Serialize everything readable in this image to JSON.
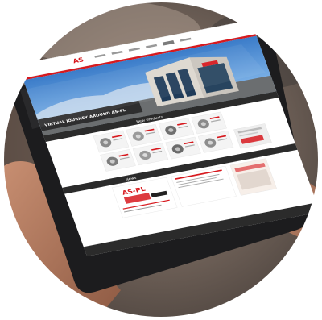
{
  "photo": {
    "subject": "tablet-showing-website",
    "colors": {
      "background_blur": "#7a6a5e",
      "tablet_frame": "#1c1c1e",
      "page_bg": "#ffffff",
      "accent_red": "#d7191e",
      "header_dark": "#2b2b2b"
    }
  },
  "website": {
    "logo": "AS",
    "nav": [
      "",
      "",
      "",
      "",
      ""
    ],
    "hero_caption": "VIRTUAL JOURNEY AROUND AS-PL",
    "section_title": "New products",
    "news_title": "News",
    "promo_brand": "AS-PL"
  }
}
